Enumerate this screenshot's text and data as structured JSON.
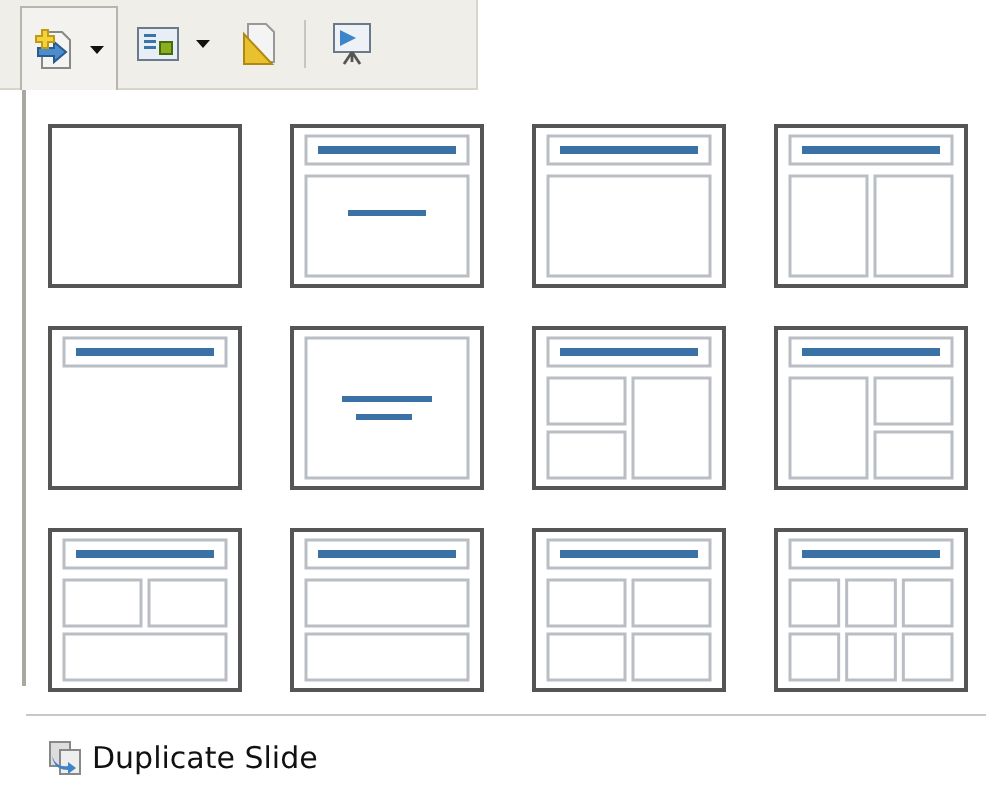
{
  "toolbar": [
    {
      "kind": "dropdown",
      "pressed": true
    },
    {
      "kind": "dropdown",
      "pressed": false
    },
    {
      "kind": "button",
      "pressed": false
    },
    {
      "kind": "separator"
    },
    {
      "kind": "button",
      "pressed": false
    }
  ],
  "layouts": [
    {
      "kind": "blank"
    },
    {
      "kind": "title-content"
    },
    {
      "kind": "title-box"
    },
    {
      "kind": "title-two-columns"
    },
    {
      "kind": "title-only"
    },
    {
      "kind": "centered-text"
    },
    {
      "kind": "title-two-left-one-right"
    },
    {
      "kind": "title-one-left-two-right"
    },
    {
      "kind": "title-two-top-one-bottom"
    },
    {
      "kind": "title-two-rows"
    },
    {
      "kind": "title-four-boxes"
    },
    {
      "kind": "title-six-boxes"
    }
  ],
  "footer": {
    "label": "Duplicate Slide"
  }
}
